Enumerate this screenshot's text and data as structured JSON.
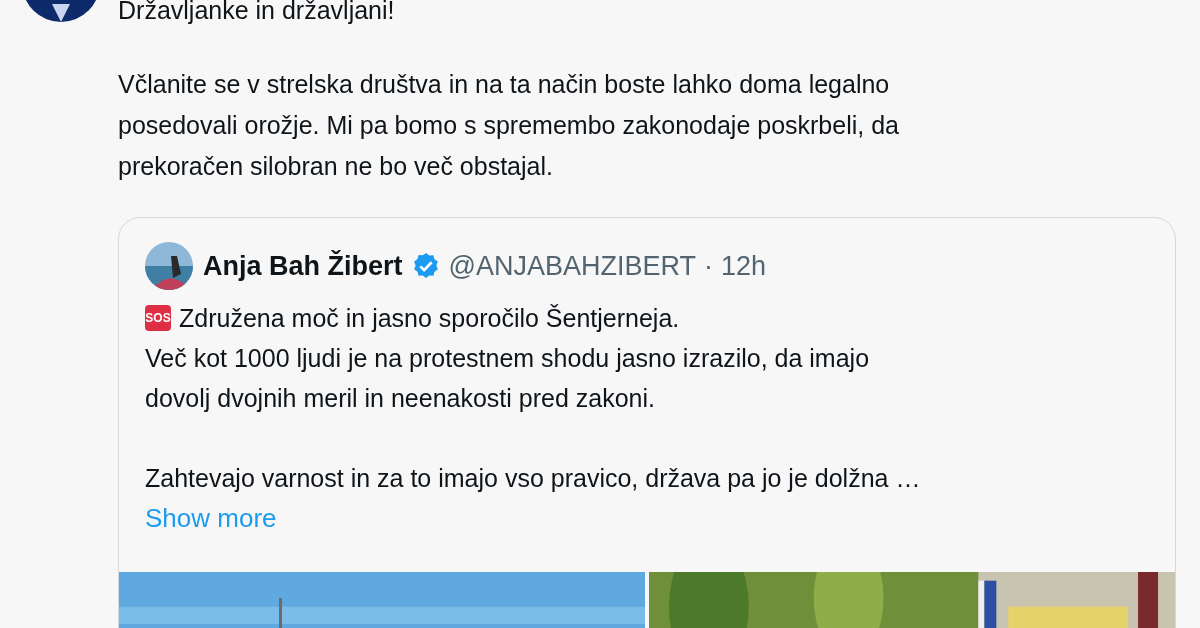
{
  "tweet": {
    "text_paragraphs": [
      "Državljanke in državljani!",
      "Včlanite se v strelska društva in na ta način boste lahko doma legalno\nposedovali orožje. Mi pa bomo s spremembo zakonodaje poskrbeli, da\nprekoračen silobran ne bo več obstajal."
    ]
  },
  "quoted_tweet": {
    "author": "Anja Bah Žibert",
    "verified": true,
    "handle": "@ANJABAHZIBERT",
    "separator": "·",
    "time": "12h",
    "emoji": "SOS",
    "first_line": "Združena moč in jasno sporočilo Šentjerneja.",
    "text_paragraphs": [
      "Več kot 1000 ljudi je na protestnem shodu jasno izrazilo, da imajo\ndovolj dvojnih meril in neenakosti pred zakoni.",
      "Zahtevajo varnost in za to imajo vso pravico, država pa jo je dolžna …"
    ],
    "show_more": "Show more"
  }
}
